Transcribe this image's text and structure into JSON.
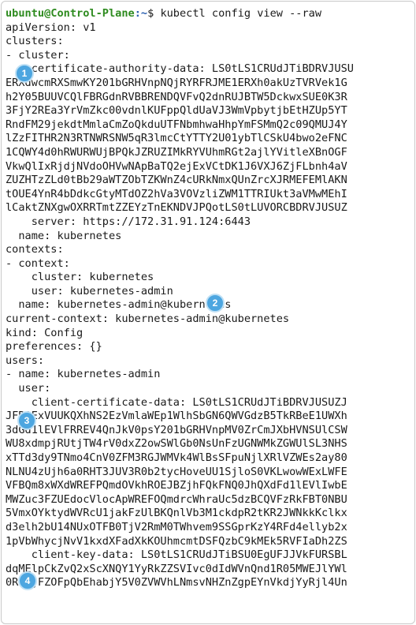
{
  "prompt": {
    "user_host": "ubuntu@Control-Plane",
    "path": ":~",
    "symbol": "$ ",
    "command": "kubectl config view --raw"
  },
  "lines": [
    "apiVersion: v1",
    "clusters:",
    "- cluster:",
    "    certificate-authority-data: LS0tLS1CRUdJTiBDRVJUSU",
    "ERXdwcmRXSmwKY201bGRHVnpNQjRYRFRJME1ERXh0akUzTVRVek1G",
    "h2Y05BUUVCQlFBRGdnRVBBRENDQVFvQ2dnRUJBTW5DckwxSUE0K3R",
    "3FjY2REa3YrVmZkc00vdnlKUFppQldUaVJ3WmVpbytjbEtHZUp5YT",
    "RndFM29jekdtMmlaCmZoQkduUTFNbmhwaHhpYmFSMmQ2c09QMUJ4Y",
    "lZzFITHR2N3RTNWRSNW5qR3lmcCtYTTY2U01ybTlCSkU4bwo2eFNC",
    "1CQWY4d0hRWURWUjBPQkJZRUZIMkRYVUhmRGt2ajlYVitleXBnOGF",
    "VkwQlIxRjdjNVdoOHVwNApBaTQ2ejExVCtDK1J6VXJ6ZjFLbnh4aV",
    "ZUZHTzZLd0tBb29aWTZObTZKWnZ4cURkNmxQUnZrcXJRMEFEMlAKN",
    "tOUE4YnR4bDdkcGtyMTdOZ2hVa3VOVzliZWM1TTRIUkt3aVMwMEhI",
    "lCaktZNXgwOXRRTmtZZEYzTnEKNDVJPQotLS0tLUVORCBDRVJUSUZ",
    "    server: https://172.31.91.124:6443",
    "  name: kubernetes",
    "contexts:",
    "- context:",
    "    cluster: kubernetes",
    "    user: kubernetes-admin",
    "  name: kubernetes-admin@kubernetes",
    "current-context: kubernetes-admin@kubernetes",
    "kind: Config",
    "preferences: {}",
    "users:",
    "- name: kubernetes-admin",
    "  user:",
    "    client-certificate-data: LS0tLS1CRUdJTiBDRVJUSUZJ",
    "JFR0ExVUUKQXhNS2EzVmlaWEp1WlhSbGN6QWVGdzB5TkRBeE1UWXh",
    "3dGd1lEVlFRREV4QnJkV0psY201bGRHVnpMV0ZrCmJXbHVNSUlCSW",
    "WU8xdmpjRUtjTW4rV0dxZ2owSWlGb0NsUnFzUGNWMkZGWUlSL3NHS",
    "xTTd3dy9TNmo4CnV0ZFM3RGJWMVk4WlBsSFpuNjlXRlVZWEs2ay80",
    "NLNU4zUjh6a0RHT3JUV3R0b2tycHoveUU1SjloS0VKLwowWExLWFE",
    "VFBQm8xWXdWREFPQmdOVkhROEJBZjhFQkFNQ0JhQXdFd1lEVlIwbE",
    "MWZuc3FZUEdocVlocApWREFOQmdrcWhraUc5dzBCQVFzRkFBT0NBU",
    "5VmxOYktydWVRcU1jakFzUlBKQnlVb3M1ckdpR2tKR2JWNkkKclkx",
    "d3elh2bU14NUxOTFB0TjV2RmM0TWhvem9SSGprKzY4RFd4ellyb2x",
    "1pVbWhycjNvV1kxdXFadXkKOUhmcmtDSFQzbC9kMEk5RVFIaDh2ZS",
    "    client-key-data: LS0tLS1CRUdJTiBSU0EgUFJJVkFURSBL",
    "dqMElpCkZvQ2xScXNQY1YyRkZZSVIvc0dIdWVnQnd1R05MWEJlYWl",
    "0RiVjFZOFpQbEhabjY5V0ZVWVhLNmsvNHZnZgpEYnVkdjYyRjl4Un"
  ],
  "badges": [
    "1",
    "2",
    "3",
    "4"
  ],
  "colors": {
    "prompt_user": "#2e8b1f",
    "prompt_path": "#2a5fb0",
    "badge": "#4da6e0",
    "text": "#1a1a1a"
  }
}
